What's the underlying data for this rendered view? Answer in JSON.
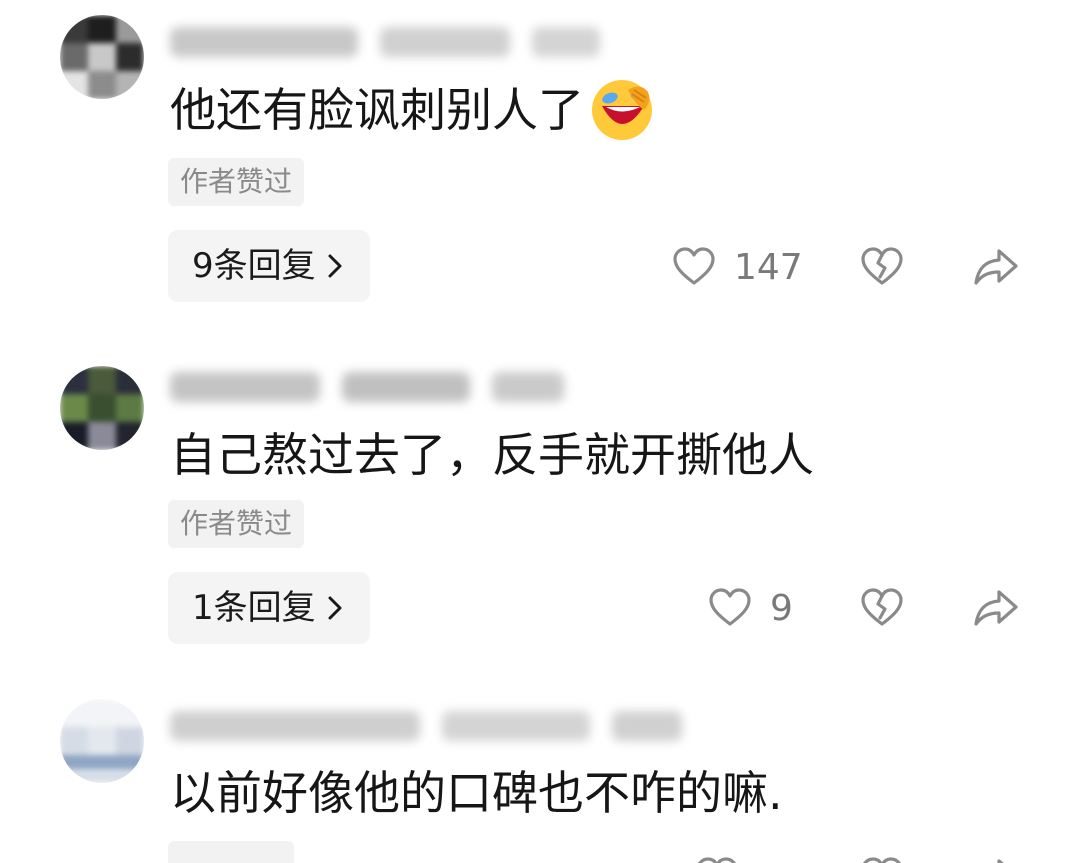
{
  "comments": [
    {
      "text": "他还有脸讽刺别人了",
      "author_badge": "作者赞过",
      "reply_label": "9条回复",
      "likes": "147"
    },
    {
      "text": "自己熬过去了，反手就开撕他人",
      "author_badge": "作者赞过",
      "reply_label": "1条回复",
      "likes": "9"
    },
    {
      "text": "以前好像他的口碑也不咋的嘛."
    }
  ],
  "icons": {
    "like": "heart-outline-icon",
    "dislike": "broken-heart-icon",
    "share": "share-arrow-icon",
    "reply_chevron": "chevron-right-icon",
    "emoji": "rolling-laughing-emoji"
  },
  "colors": {
    "text": "#161616",
    "muted": "#8a8a8a",
    "tag_bg": "#f2f2f2",
    "reply_bg": "#f4f4f4"
  }
}
